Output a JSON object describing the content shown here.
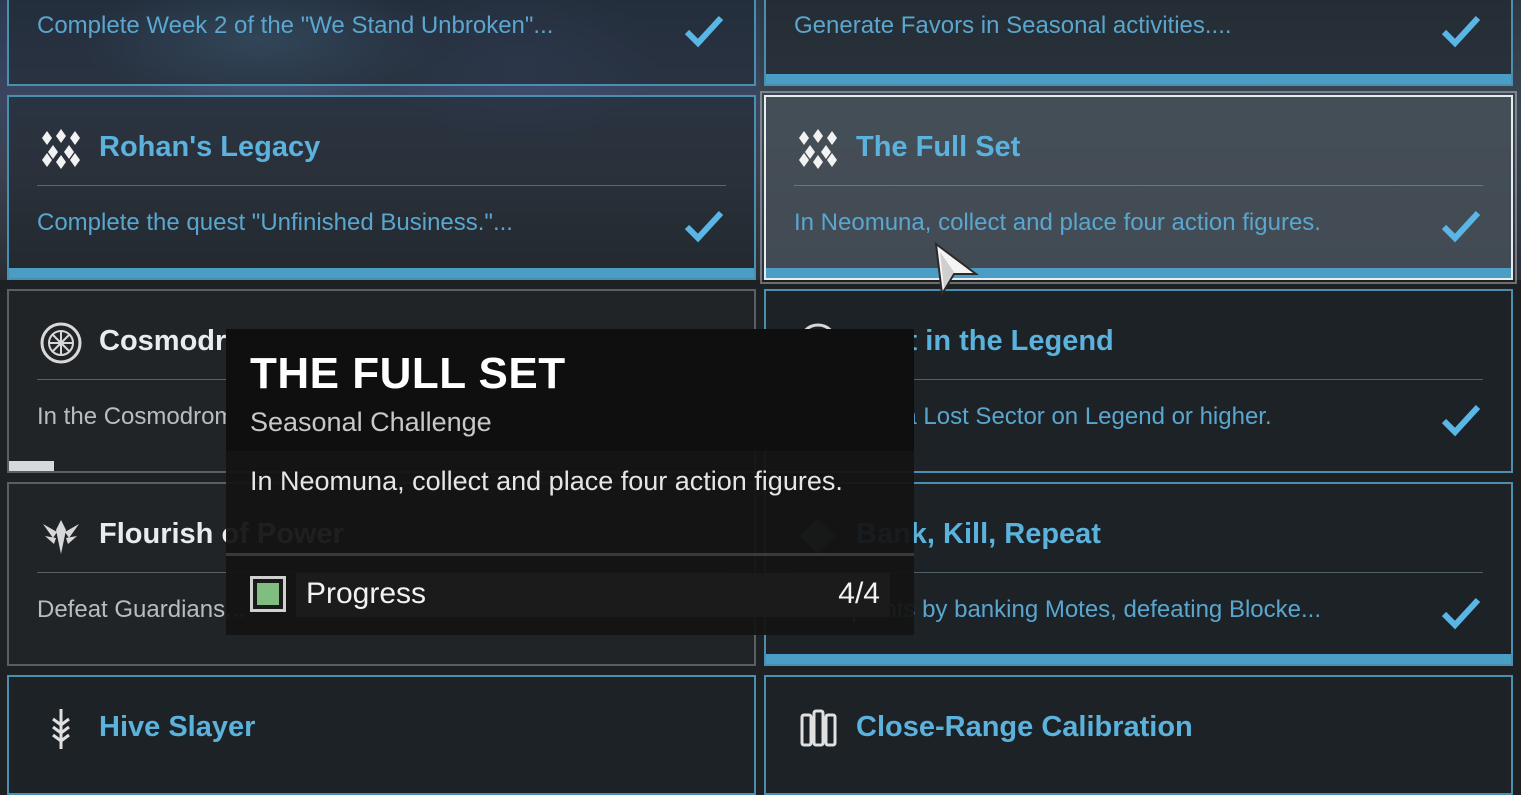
{
  "challenges": [
    {
      "title": "",
      "description": "Complete Week 2 of the \"We Stand Unbroken\"...",
      "complete": true,
      "icon": "none"
    },
    {
      "title": "",
      "description": "Generate Favors in Seasonal activities....",
      "complete": true,
      "icon": "none"
    },
    {
      "title": "Rohan's Legacy",
      "description": "Complete the quest \"Unfinished Business.\"...",
      "complete": true,
      "icon": "diamond-cluster-icon"
    },
    {
      "title": "The Full Set",
      "description": "In Neomuna, collect and place four action figures.",
      "complete": true,
      "icon": "diamond-cluster-icon"
    },
    {
      "title": "Cosmodrome Activities",
      "description": "In the Cosmodrome...",
      "complete": false,
      "icon": "cosmodrome-icon"
    },
    {
      "title": "Lost in the Legend",
      "description": "Complete a Lost Sector on Legend or higher.",
      "complete": true,
      "icon": "lost-sector-icon"
    },
    {
      "title": "Flourish of Power",
      "description": "Defeat Guardians...",
      "complete": false,
      "icon": "winged-crest-icon"
    },
    {
      "title": "Bank, Kill, Repeat",
      "description": "Earn points by banking Motes, defeating Blocke...",
      "complete": true,
      "icon": "gambit-icon"
    },
    {
      "title": "Hive Slayer",
      "description": "",
      "complete": false,
      "icon": "hive-sword-icon"
    },
    {
      "title": "Close-Range Calibration",
      "description": "",
      "complete": false,
      "icon": "shotgun-shells-icon"
    }
  ],
  "tooltip": {
    "title": "THE FULL SET",
    "subtitle": "Seasonal Challenge",
    "description": "In Neomuna, collect and place four action figures.",
    "progress_label": "Progress",
    "progress_value": "4/4",
    "progress_fraction": 1.0
  },
  "cosmodrome_progress_fraction": 0.06,
  "colors": {
    "accent": "#4a9dc4",
    "title_blue": "#5bb2dd",
    "progress_green": "#7fbe7e"
  }
}
